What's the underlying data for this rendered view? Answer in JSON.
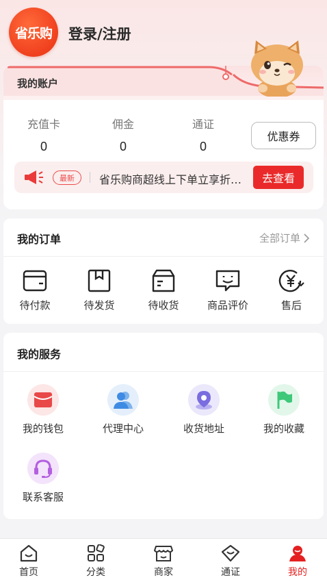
{
  "header": {
    "logo_text": "省乐购",
    "login_label": "登录/注册"
  },
  "account": {
    "title": "我的账户",
    "stats": [
      {
        "label": "充值卡",
        "value": "0"
      },
      {
        "label": "佣金",
        "value": "0"
      },
      {
        "label": "通证",
        "value": "0"
      }
    ],
    "coupon_label": "优惠券"
  },
  "notice": {
    "badge": "最新",
    "text": "省乐购商超线上下单立享折…",
    "button": "去查看"
  },
  "orders": {
    "title": "我的订单",
    "all_label": "全部订单",
    "items": [
      {
        "label": "待付款",
        "icon": "wallet-icon"
      },
      {
        "label": "待发货",
        "icon": "box-icon"
      },
      {
        "label": "待收货",
        "icon": "delivery-box-icon"
      },
      {
        "label": "商品评价",
        "icon": "comment-icon"
      },
      {
        "label": "售后",
        "icon": "yuan-refund-icon"
      }
    ]
  },
  "services": {
    "title": "我的服务",
    "items": [
      {
        "label": "我的钱包",
        "icon": "red-envelope-icon",
        "color": "#e94848"
      },
      {
        "label": "代理中心",
        "icon": "users-icon",
        "color": "#3f8be3"
      },
      {
        "label": "收货地址",
        "icon": "location-pin-icon",
        "color": "#7a6de0"
      },
      {
        "label": "我的收藏",
        "icon": "flag-icon",
        "color": "#3fc87a"
      },
      {
        "label": "联系客服",
        "icon": "headset-icon",
        "color": "#b35fe0"
      }
    ]
  },
  "tabbar": {
    "items": [
      {
        "label": "首页",
        "icon": "home-icon",
        "active": false
      },
      {
        "label": "分类",
        "icon": "category-icon",
        "active": false
      },
      {
        "label": "商家",
        "icon": "store-icon",
        "active": false
      },
      {
        "label": "通证",
        "icon": "token-icon",
        "active": false
      },
      {
        "label": "我的",
        "icon": "profile-icon",
        "active": true
      }
    ]
  },
  "colors": {
    "accent": "#ea2a2a",
    "logo": "#f0401e"
  }
}
